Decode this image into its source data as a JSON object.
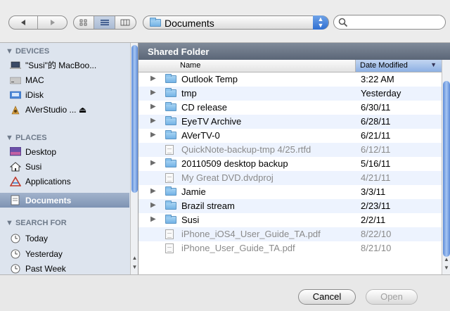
{
  "toolbar": {
    "back_icon": "back-arrow-icon",
    "forward_icon": "forward-arrow-icon",
    "view_modes": [
      "icon-view",
      "list-view",
      "column-view"
    ],
    "location": "Documents",
    "search_placeholder": ""
  },
  "sidebar": {
    "devices_header": "▼ DEVICES",
    "devices": [
      {
        "label": "\"Susi\"的 MacBoo...",
        "icon": "laptop-icon"
      },
      {
        "label": "MAC",
        "icon": "hard-drive-icon"
      },
      {
        "label": "iDisk",
        "icon": "idisk-icon"
      },
      {
        "label": "AVerStudio ... ⏏",
        "icon": "installer-icon"
      }
    ],
    "places_header": "▼ PLACES",
    "places": [
      {
        "label": "Desktop",
        "icon": "desktop-icon"
      },
      {
        "label": "Susi",
        "icon": "home-icon"
      },
      {
        "label": "Applications",
        "icon": "applications-icon"
      },
      {
        "label": "Documents",
        "icon": "documents-icon",
        "selected": true
      }
    ],
    "search_header": "▼ SEARCH FOR",
    "searches": [
      {
        "label": "Today",
        "icon": "clock-icon"
      },
      {
        "label": "Yesterday",
        "icon": "clock-icon"
      },
      {
        "label": "Past Week",
        "icon": "clock-icon"
      }
    ]
  },
  "main": {
    "title": "Shared Folder",
    "col_name": "Name",
    "col_date": "Date Modified",
    "files": [
      {
        "name": "Outlook Temp",
        "date": "3:22 AM",
        "type": "folder",
        "enabled": true
      },
      {
        "name": "tmp",
        "date": "Yesterday",
        "type": "folder",
        "enabled": true
      },
      {
        "name": "CD release",
        "date": "6/30/11",
        "type": "folder",
        "enabled": true
      },
      {
        "name": "EyeTV Archive",
        "date": "6/28/11",
        "type": "folder",
        "enabled": true
      },
      {
        "name": "AVerTV-0",
        "date": "6/21/11",
        "type": "folder",
        "enabled": true
      },
      {
        "name": "QuickNote-backup-tmp 4/25.rtfd",
        "date": "6/12/11",
        "type": "file",
        "enabled": false
      },
      {
        "name": "20110509 desktop backup",
        "date": "5/16/11",
        "type": "folder",
        "enabled": true
      },
      {
        "name": "My Great DVD.dvdproj",
        "date": "4/21/11",
        "type": "file",
        "enabled": false
      },
      {
        "name": "Jamie",
        "date": "3/3/11",
        "type": "folder",
        "enabled": true
      },
      {
        "name": "Brazil stream",
        "date": "2/23/11",
        "type": "folder",
        "enabled": true
      },
      {
        "name": "Susi",
        "date": "2/2/11",
        "type": "folder",
        "enabled": true
      },
      {
        "name": "iPhone_iOS4_User_Guide_TA.pdf",
        "date": "8/22/10",
        "type": "file",
        "enabled": false
      },
      {
        "name": "iPhone_User_Guide_TA.pdf",
        "date": "8/21/10",
        "type": "file",
        "enabled": false
      }
    ]
  },
  "buttons": {
    "cancel": "Cancel",
    "open": "Open"
  }
}
